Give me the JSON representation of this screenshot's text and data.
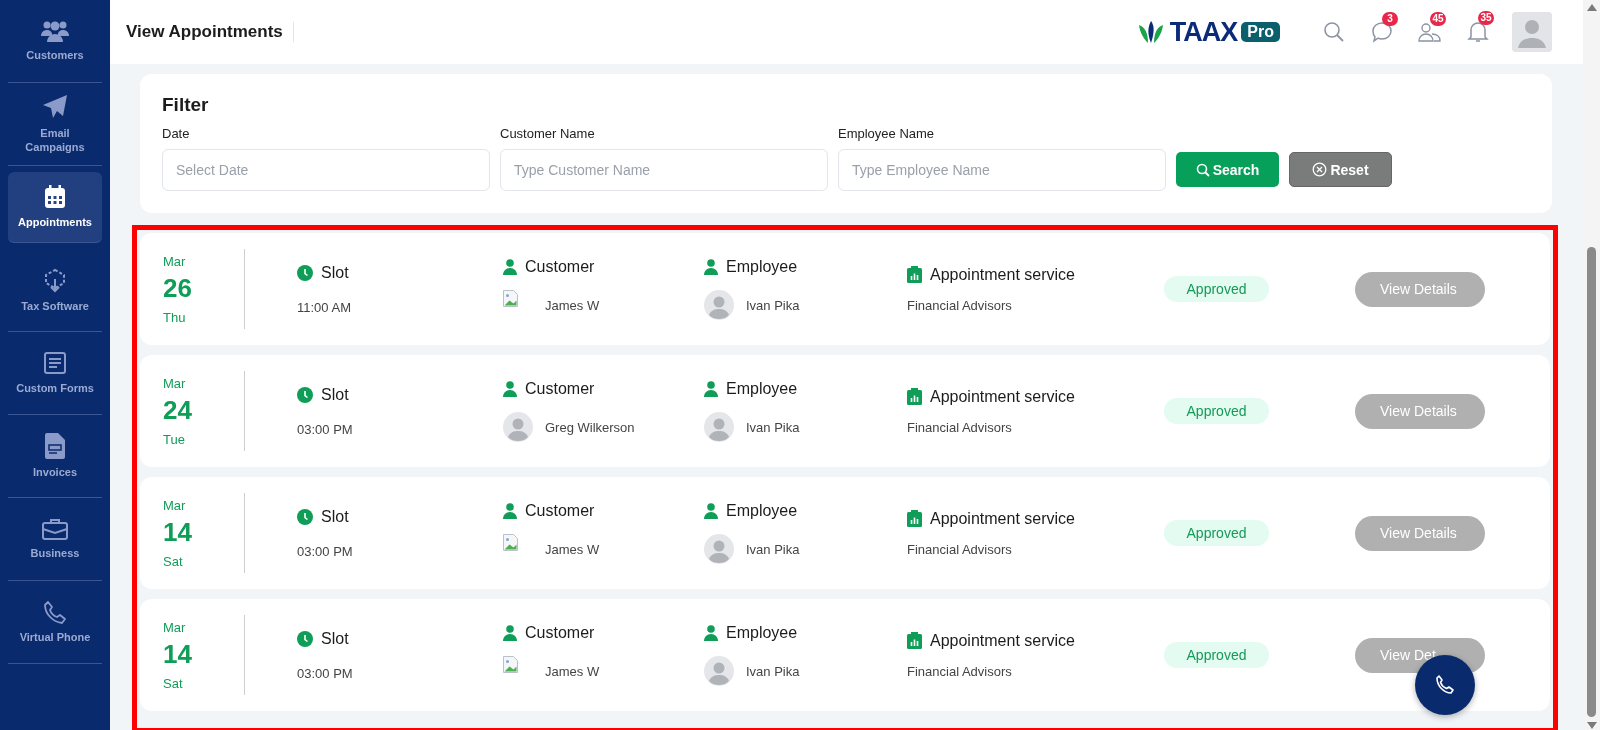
{
  "sidebar": {
    "items": [
      {
        "label": "Customers",
        "selected": false
      },
      {
        "label": "Email Campaigns",
        "selected": false
      },
      {
        "label": "Appointments",
        "selected": true
      },
      {
        "label": "Tax Software",
        "selected": false
      },
      {
        "label": "Custom Forms",
        "selected": false
      },
      {
        "label": "Invoices",
        "selected": false
      },
      {
        "label": "Business",
        "selected": false
      },
      {
        "label": "Virtual Phone",
        "selected": false
      }
    ]
  },
  "header": {
    "title": "View Appointments",
    "logo": {
      "text": "TAAX",
      "badge": "Pro"
    },
    "icons": [
      {
        "kind": "search"
      },
      {
        "kind": "chat",
        "badge": "3"
      },
      {
        "kind": "users",
        "badge": "45"
      },
      {
        "kind": "bell",
        "badge": "35"
      }
    ]
  },
  "filter": {
    "title": "Filter",
    "fields": [
      {
        "label": "Date",
        "placeholder": "Select Date"
      },
      {
        "label": "Customer Name",
        "placeholder": "Type Customer Name"
      },
      {
        "label": "Employee Name",
        "placeholder": "Type Employee Name"
      }
    ],
    "buttons": [
      {
        "label": "Search",
        "kind": "primary"
      },
      {
        "label": "Reset",
        "kind": "secondary"
      }
    ]
  },
  "appointments": [
    {
      "month": "Mar",
      "day": "26",
      "weekday": "Thu",
      "slot_label": "Slot",
      "time": "11:00 AM",
      "customer_label": "Customer",
      "customer": {
        "name": "James W",
        "kind": "broken"
      },
      "employee_label": "Employee",
      "employee": {
        "name": "Ivan Pika",
        "kind": "placeholder"
      },
      "service_label": "Appointment service",
      "service": "Financial Advisors",
      "status": "Approved",
      "action": "View Details"
    },
    {
      "month": "Mar",
      "day": "24",
      "weekday": "Tue",
      "slot_label": "Slot",
      "time": "03:00 PM",
      "customer_label": "Customer",
      "customer": {
        "name": "Greg Wilkerson",
        "kind": "placeholder"
      },
      "employee_label": "Employee",
      "employee": {
        "name": "Ivan Pika",
        "kind": "placeholder"
      },
      "service_label": "Appointment service",
      "service": "Financial Advisors",
      "status": "Approved",
      "action": "View Details"
    },
    {
      "month": "Mar",
      "day": "14",
      "weekday": "Sat",
      "slot_label": "Slot",
      "time": "03:00 PM",
      "customer_label": "Customer",
      "customer": {
        "name": "James W",
        "kind": "broken"
      },
      "employee_label": "Employee",
      "employee": {
        "name": "Ivan Pika",
        "kind": "placeholder"
      },
      "service_label": "Appointment service",
      "service": "Financial Advisors",
      "status": "Approved",
      "action": "View Details"
    },
    {
      "month": "Mar",
      "day": "14",
      "weekday": "Sat",
      "slot_label": "Slot",
      "time": "03:00 PM",
      "customer_label": "Customer",
      "customer": {
        "name": "James W",
        "kind": "broken"
      },
      "employee_label": "Employee",
      "employee": {
        "name": "Ivan Pika",
        "kind": "placeholder"
      },
      "service_label": "Appointment service",
      "service": "Financial Advisors",
      "status": "Approved",
      "action": "View Det"
    }
  ]
}
